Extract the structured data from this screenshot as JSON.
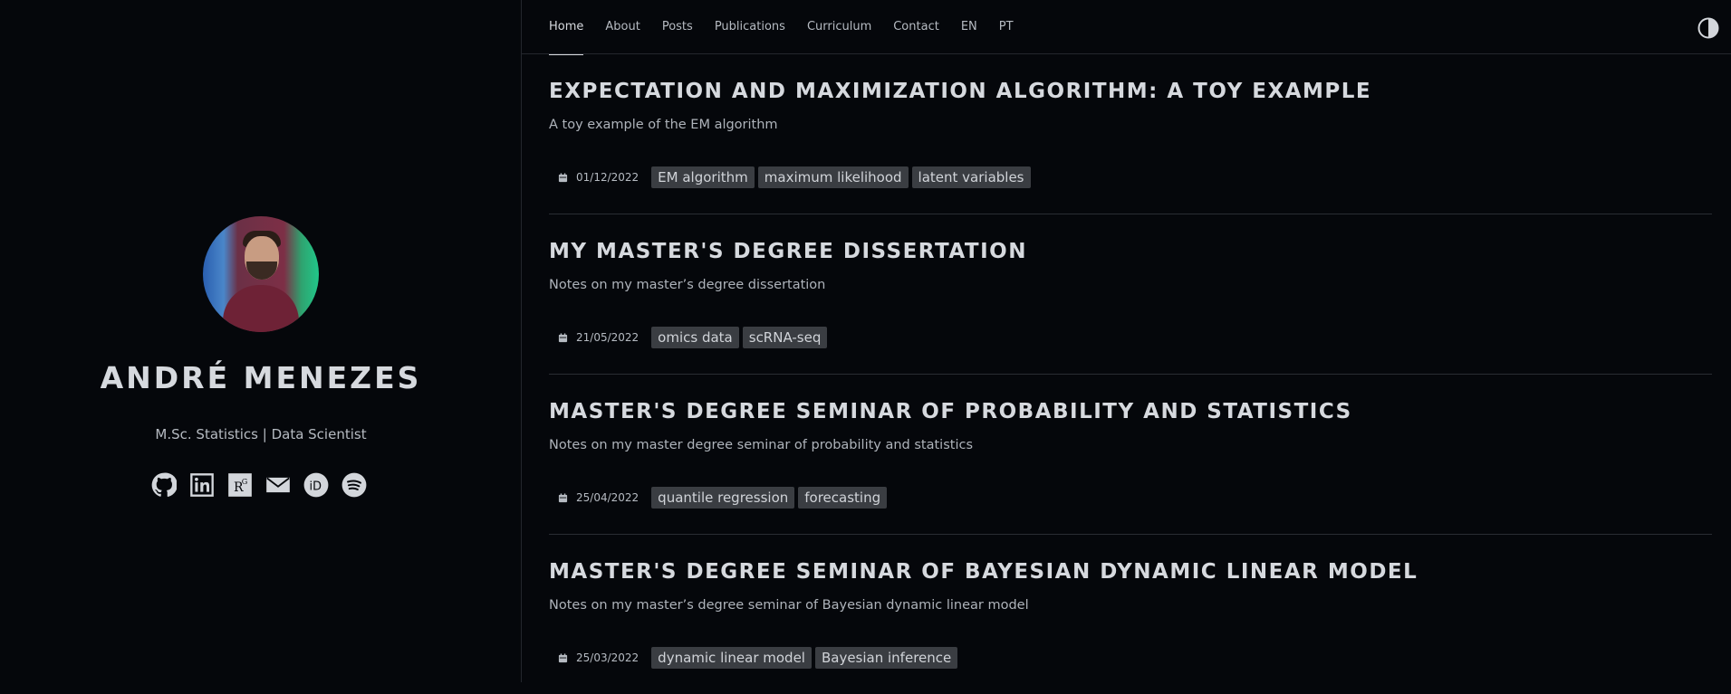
{
  "author": {
    "name": "ANDRÉ MENEZES",
    "description": "M.Sc. Statistics | Data Scientist",
    "social_icons": [
      "github-icon",
      "linkedin-icon",
      "researchgate-icon",
      "email-icon",
      "orcid-icon",
      "spotify-icon"
    ]
  },
  "nav": {
    "items": [
      "Home",
      "About",
      "Posts",
      "Publications",
      "Curriculum",
      "Contact",
      "EN",
      "PT"
    ],
    "active": "Home",
    "theme_icon": "contrast-icon"
  },
  "posts": [
    {
      "title": "EXPECTATION AND MAXIMIZATION ALGORITHM: A TOY EXAMPLE",
      "summary": "A toy example of the EM algorithm",
      "date": "01/12/2022",
      "tags": [
        "EM algorithm",
        "maximum likelihood",
        "latent variables"
      ]
    },
    {
      "title": "MY MASTER'S DEGREE DISSERTATION",
      "summary": "Notes on my master’s degree dissertation",
      "date": "21/05/2022",
      "tags": [
        "omics data",
        "scRNA-seq"
      ]
    },
    {
      "title": "MASTER'S DEGREE SEMINAR OF PROBABILITY AND STATISTICS",
      "summary": "Notes on my master degree seminar of probability and statistics",
      "date": "25/04/2022",
      "tags": [
        "quantile regression",
        "forecasting"
      ]
    },
    {
      "title": "MASTER'S DEGREE SEMINAR OF BAYESIAN DYNAMIC LINEAR MODEL",
      "summary": "Notes on my master’s degree seminar of Bayesian dynamic linear model",
      "date": "25/03/2022",
      "tags": [
        "dynamic linear model",
        "Bayesian inference"
      ]
    }
  ]
}
